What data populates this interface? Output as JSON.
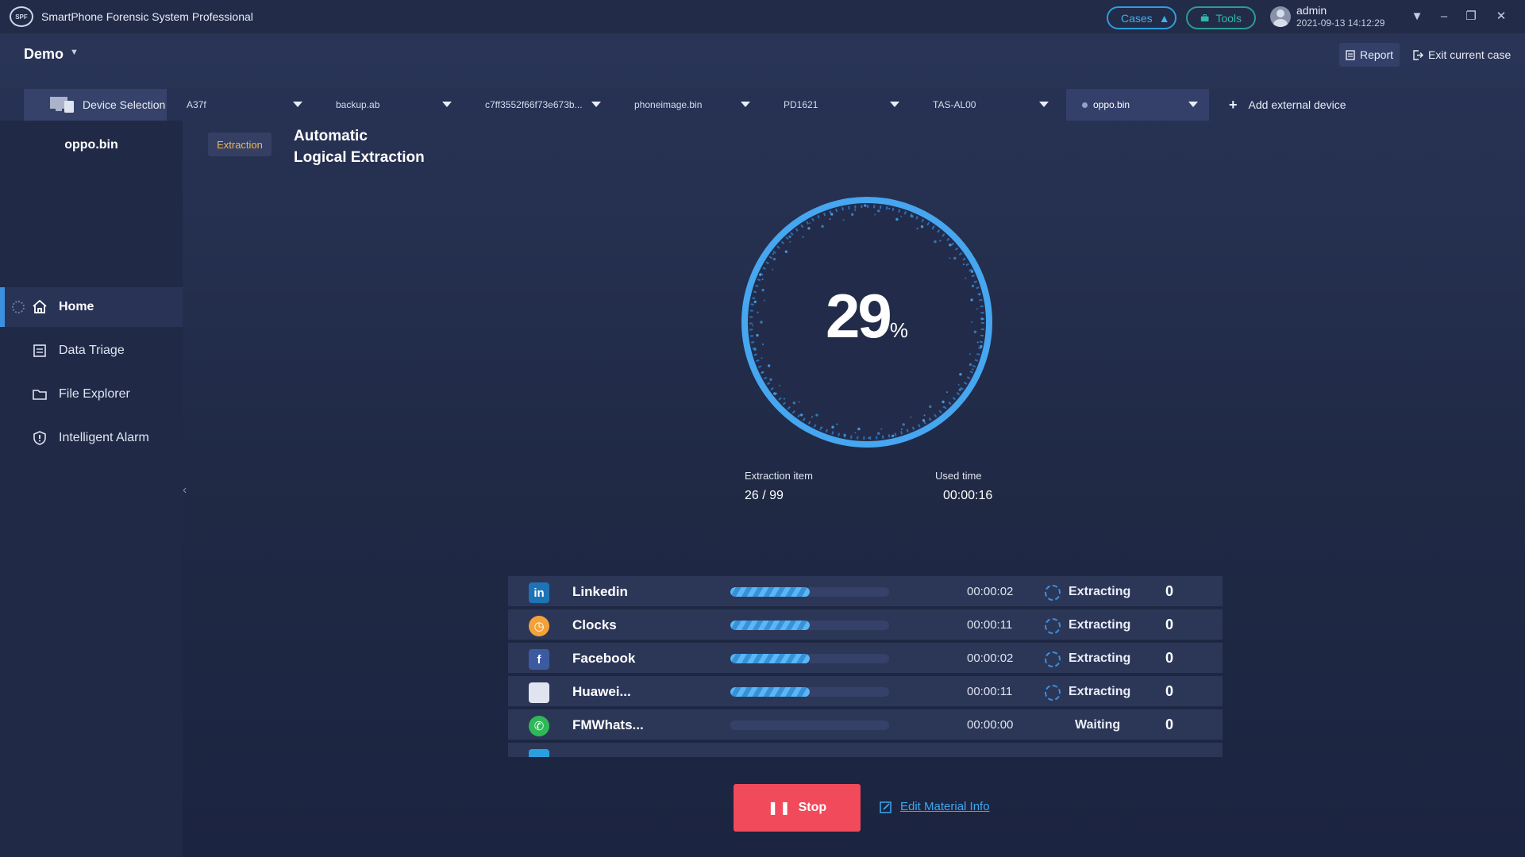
{
  "app": {
    "logo_text": "SPF",
    "title": "SmartPhone Forensic System Professional",
    "cases_label": "Cases",
    "tools_label": "Tools",
    "user": {
      "name": "admin",
      "datetime": "2021-09-13 14:12:29"
    }
  },
  "case": {
    "name": "Demo",
    "report_label": "Report",
    "exit_label": "Exit current case"
  },
  "device_bar": {
    "selection_label": "Device Selection",
    "devices": [
      "A37f",
      "backup.ab",
      "c7ff3552f66f73e673b...",
      "phoneimage.bin",
      "PD1621",
      "TAS-AL00",
      "oppo.bin"
    ],
    "active_index": 6,
    "add_label": "Add external device"
  },
  "sidebar": {
    "device_name": "oppo.bin",
    "items": [
      {
        "label": "Home",
        "icon": "home-icon"
      },
      {
        "label": "Data Triage",
        "icon": "document-icon"
      },
      {
        "label": "File Explorer",
        "icon": "folder-icon"
      },
      {
        "label": "Intelligent Alarm",
        "icon": "alarm-shield-icon"
      }
    ],
    "active_index": 0
  },
  "main": {
    "badge": "Extraction",
    "mode_title_line1": "Automatic",
    "mode_title_line2": "Logical Extraction",
    "progress_percent": 29,
    "percent_sign": "%",
    "extraction_item_label": "Extraction item",
    "extraction_item_value": "26 / 99",
    "used_time_label": "Used time",
    "used_time_value": "00:00:16",
    "items": [
      {
        "name": "Linkedin",
        "icon": "linkedin-icon",
        "progress": 0.5,
        "time": "00:00:02",
        "status": "Extracting",
        "count": "0"
      },
      {
        "name": "Clocks",
        "icon": "clock-icon",
        "progress": 0.5,
        "time": "00:00:11",
        "status": "Extracting",
        "count": "0"
      },
      {
        "name": "Facebook",
        "icon": "facebook-icon",
        "progress": 0.5,
        "time": "00:00:02",
        "status": "Extracting",
        "count": "0"
      },
      {
        "name": "Huawei...",
        "icon": "huawei-app-icon",
        "progress": 0.5,
        "time": "00:00:11",
        "status": "Extracting",
        "count": "0"
      },
      {
        "name": "FMWhats...",
        "icon": "whatsapp-icon",
        "progress": 0,
        "time": "00:00:00",
        "status": "Waiting",
        "count": "0"
      }
    ],
    "stop_label": "Stop",
    "edit_label": "Edit Material Info"
  },
  "colors": {
    "accent": "#3d9be9",
    "stop": "#f14a5b",
    "badge_text": "#f0b84a",
    "ring": "#46a6f0"
  }
}
